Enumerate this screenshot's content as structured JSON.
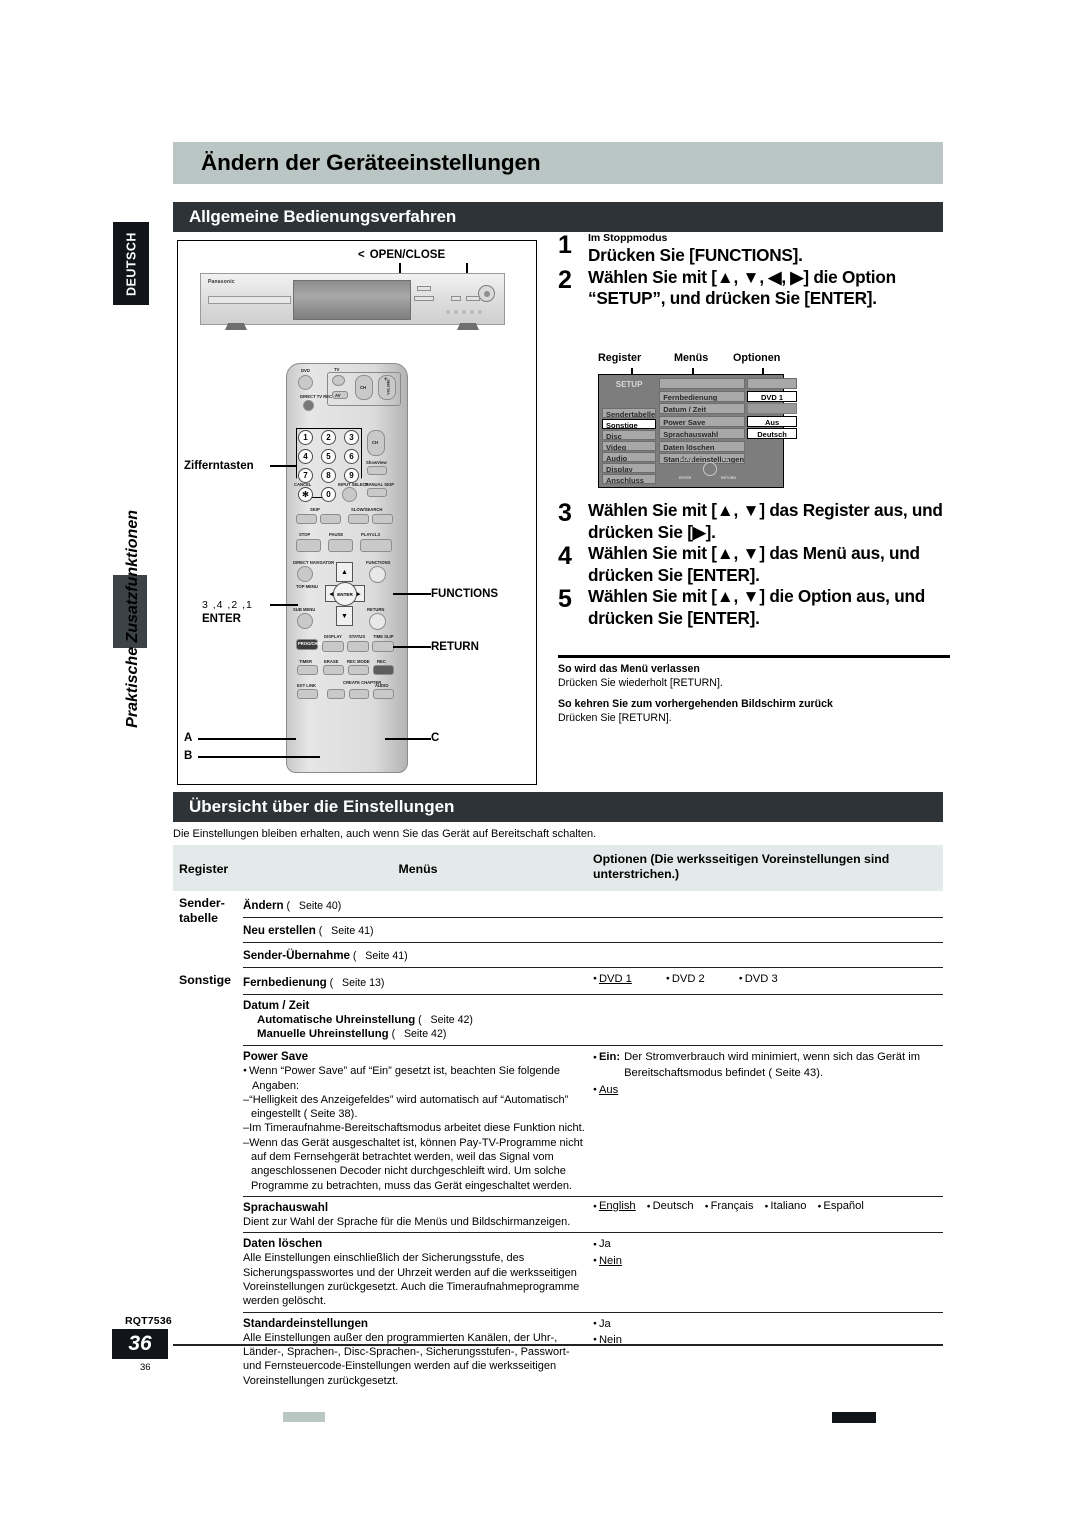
{
  "sidebar": {
    "language_tab": "DEUTSCH",
    "section_label": "Praktische Zusatzfunktionen"
  },
  "header": {
    "title": "Ändern der Geräteeinstellungen",
    "section1": "Allgemeine Bedienungsverfahren",
    "section2": "Übersicht über die Einstellungen"
  },
  "illustration": {
    "open_close_chevron": "<",
    "open_close_label": "OPEN/CLOSE",
    "brand": "Panasonic",
    "zifferntasten": "Zifferntasten",
    "enter_callout_numbers": "3 ,4 ,2 ,1",
    "enter_callout_label": "ENTER",
    "functions_label": "FUNCTIONS",
    "return_label": "RETURN",
    "label_a": "A",
    "label_b": "B",
    "label_c": "C",
    "remote_keys": {
      "dvd": "DVD",
      "tv": "TV",
      "direct_tv_rec": "DIRECT TV REC",
      "av": "AV",
      "ch": "CH",
      "volume": "VOLUME",
      "plus": "+",
      "minus": "–",
      "showview": "ShowView",
      "manual_skip": "MANUAL SKIP",
      "cancel": "CANCEL",
      "asterisk": "✻",
      "input_select": "INPUT SELECT",
      "skip": "SKIP",
      "slow_search": "SLOW/SEARCH",
      "stop": "STOP",
      "pause": "PAUSE",
      "play": "PLAYx1.3",
      "direct_navigator": "DIRECT NAVIGATOR",
      "top_menu": "TOP MENU",
      "sub_menu": "SUB MENU",
      "functions": "FUNCTIONS",
      "return": "RETURN",
      "enter": "ENTER",
      "prog_check": "PROG/CHECK",
      "display": "DISPLAY",
      "status": "STATUS",
      "time_slip": "TIME SLIP",
      "timer": "TIMER",
      "erase": "ERASE",
      "rec_mode": "REC MODE",
      "rec": "REC",
      "ext_link": "EXT LINK",
      "create_chapter": "CREATE CHAPTER",
      "audio": "AUDIO",
      "digits": [
        "1",
        "2",
        "3",
        "4",
        "5",
        "6",
        "7",
        "8",
        "9",
        "0"
      ]
    }
  },
  "steps": [
    {
      "n": "1",
      "pre": "Im Stoppmodus",
      "text": "Drücken Sie [FUNCTIONS]."
    },
    {
      "n": "2",
      "pre": "",
      "text": "Wählen Sie mit [▲, ▼, ◀, ▶] die Option “SETUP”, und drücken Sie [ENTER]."
    },
    {
      "n": "3",
      "pre": "",
      "text": "Wählen Sie mit [▲, ▼] das Register aus, und drücken Sie [▶]."
    },
    {
      "n": "4",
      "pre": "",
      "text": "Wählen Sie mit [▲, ▼] das Menü aus, und drücken Sie [ENTER]."
    },
    {
      "n": "5",
      "pre": "",
      "text": "Wählen Sie mit [▲, ▼] die Option aus, und drücken Sie [ENTER]."
    }
  ],
  "osd": {
    "callouts": {
      "register": "Register",
      "menus": "Menüs",
      "optionen": "Optionen"
    },
    "title": "SETUP",
    "tabs": [
      {
        "label": "Sendertabelle",
        "selected": false
      },
      {
        "label": "Sonstige",
        "selected": true
      },
      {
        "label": "Disc",
        "selected": false
      },
      {
        "label": "Video",
        "selected": false
      },
      {
        "label": "Audio",
        "selected": false
      },
      {
        "label": "Display",
        "selected": false
      },
      {
        "label": "Anschluss",
        "selected": false
      }
    ],
    "menus": [
      "Fernbedienung",
      "Datum / Zeit",
      "Power Save",
      "Sprachauswahl",
      "Daten löschen",
      "Standardeinstellungen"
    ],
    "options": [
      "DVD 1",
      "",
      "Aus",
      "Deutsch",
      "",
      ""
    ],
    "nav_hint": {
      "select": "SELECT",
      "tab": "TAB",
      "enter": "ENTER",
      "return": "RETURN"
    }
  },
  "notes": [
    {
      "head": "So wird das Menü verlassen",
      "body": "Drücken Sie wiederholt [RETURN]."
    },
    {
      "head": "So kehren Sie zum vorhergehenden Bildschirm zurück",
      "body": "Drücken Sie [RETURN]."
    }
  ],
  "overview": {
    "intro": "Die Einstellungen bleiben erhalten, auch wenn Sie das Gerät auf Bereitschaft schalten.",
    "columns": {
      "register": "Register",
      "menus": "Menüs",
      "optionen": "Optionen (Die werksseitigen Voreinstellungen sind unterstrichen.)"
    },
    "groups": [
      {
        "register": "Sender-tabelle",
        "register_line1": "Sender-",
        "register_line2": "tabelle",
        "rows": [
          {
            "menu": "Ändern",
            "page": "Seite 40",
            "options": []
          },
          {
            "menu": "Neu erstellen",
            "page": "Seite 41",
            "options": []
          },
          {
            "menu": "Sender-Übernahme",
            "page": "Seite 41",
            "options": []
          }
        ]
      },
      {
        "register": "Sonstige",
        "register_line1": "Sonstige",
        "register_line2": "",
        "rows": [
          {
            "menu": "Fernbedienung",
            "page": "Seite 13",
            "options": [
              {
                "text": "DVD 1",
                "underlined": true
              },
              {
                "text": "DVD 2",
                "underlined": false
              },
              {
                "text": "DVD 3",
                "underlined": false
              }
            ]
          },
          {
            "menu": "Datum / Zeit",
            "page": "",
            "subitems": [
              {
                "text": "Automatische Uhreinstellung",
                "page": "Seite 42"
              },
              {
                "text": "Manuelle Uhreinstellung",
                "page": "Seite 42"
              }
            ],
            "options": []
          },
          {
            "menu": "Power Save",
            "page": "",
            "bullets": [
              "Wenn “Power Save” auf “Ein” gesetzt ist, beachten Sie folgende Angaben:"
            ],
            "dashes": [
              "“Helligkeit des Anzeigefeldes” wird automatisch auf “Automatisch” eingestellt (  Seite 38).",
              "Im Timeraufnahme-Bereitschaftsmodus arbeitet diese Funktion nicht.",
              "Wenn das Gerät ausgeschaltet ist, können Pay-TV-Programme nicht auf dem Fernsehgerät betrachtet werden, weil das Signal vom angeschlossenen Decoder nicht durchgeschleift wird. Um solche Programme zu betrachten, muss das Gerät eingeschaltet werden."
            ],
            "option_block": [
              {
                "text": "Ein:",
                "desc": "Der Stromverbrauch wird minimiert, wenn sich das Gerät im Bereitschaftsmodus befindet (  Seite 43).",
                "underlined": false
              },
              {
                "text": "Aus",
                "desc": "",
                "underlined": true
              }
            ]
          },
          {
            "menu": "Sprachauswahl",
            "page": "",
            "desc": "Dient zur Wahl der Sprache für die Menüs und Bildschirmanzeigen.",
            "options": [
              {
                "text": "English",
                "underlined": true
              },
              {
                "text": "Deutsch",
                "underlined": false
              },
              {
                "text": "Français",
                "underlined": false
              },
              {
                "text": "Italiano",
                "underlined": false
              },
              {
                "text": "Español",
                "underlined": false
              }
            ]
          },
          {
            "menu": "Daten löschen",
            "page": "",
            "desc": "Alle Einstellungen einschließlich der Sicherungsstufe, des Sicherungspasswortes und der Uhrzeit werden auf die werksseitigen Voreinstellungen zurückgesetzt. Auch die Timeraufnahmeprogramme werden gelöscht.",
            "options_stacked": [
              {
                "text": "Ja",
                "underlined": false
              },
              {
                "text": "Nein",
                "underlined": true
              }
            ]
          },
          {
            "menu": "Standardeinstellungen",
            "page": "",
            "desc": "Alle Einstellungen außer den programmierten Kanälen, der Uhr-, Länder-, Sprachen-, Disc-Sprachen-, Sicherungsstufen-, Passwort- und Fernsteuercode-Einstellungen werden auf die werksseitigen Voreinstellungen zurückgesetzt.",
            "options_stacked": [
              {
                "text": "Ja",
                "underlined": false
              },
              {
                "text": "Nein",
                "underlined": true
              }
            ]
          }
        ]
      }
    ]
  },
  "footer": {
    "rqt": "RQT7536",
    "page_big": "36",
    "page_small": "36"
  }
}
